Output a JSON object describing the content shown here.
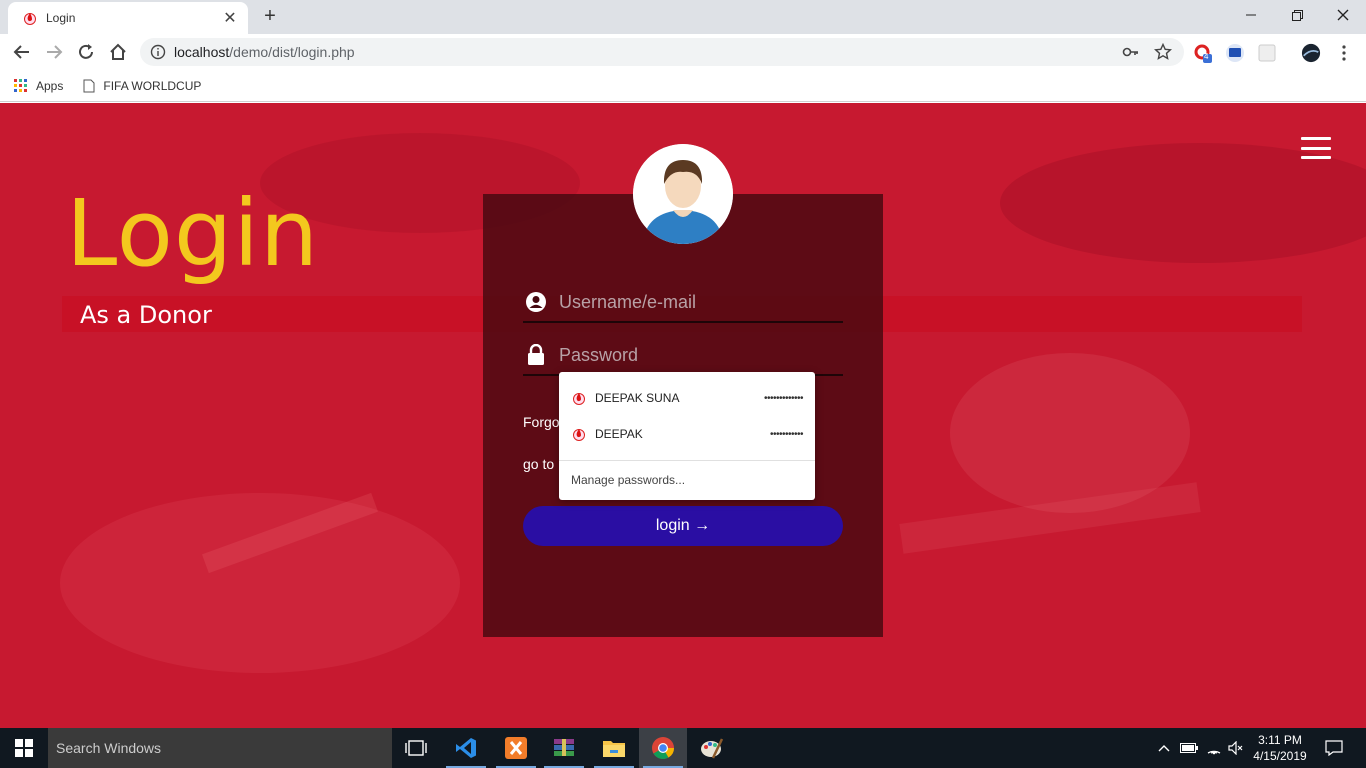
{
  "browser": {
    "tab": {
      "title": "Login",
      "close": "✕"
    },
    "new_tab": "+",
    "window_controls": {
      "minimize": "—",
      "restore": "❐",
      "close": "✕"
    },
    "url": {
      "host": "localhost",
      "path": "/demo/dist/login.php"
    },
    "extensions": {
      "badge_count": "4"
    },
    "bookmarks": [
      {
        "label": "Apps",
        "icon": "apps-grid-icon"
      },
      {
        "label": "FIFA WORLDCUP",
        "icon": "page-icon"
      }
    ]
  },
  "page": {
    "heading": "Login",
    "subheading": "As a Donor",
    "username_placeholder": "Username/e-mail",
    "password_placeholder": "Password",
    "forgot_text": "Forgo",
    "goto_text": "go to",
    "login_button": "login →",
    "colors": {
      "background": "#c71930",
      "heading": "#f3c81e",
      "button": "#2a0ea3",
      "card": "#460810"
    }
  },
  "password_dropdown": {
    "entries": [
      {
        "username": "DEEPAK SUNA",
        "masked": "•••••••••••••"
      },
      {
        "username": "DEEPAK",
        "masked": "•••••••••••"
      }
    ],
    "manage_label": "Manage passwords..."
  },
  "taskbar": {
    "search_placeholder": "Search Windows",
    "apps": [
      "task-view-icon",
      "vscode-icon",
      "xampp-icon",
      "winrar-icon",
      "file-explorer-icon",
      "chrome-icon",
      "paint-icon"
    ],
    "time": "3:11 PM",
    "date": "4/15/2019"
  }
}
